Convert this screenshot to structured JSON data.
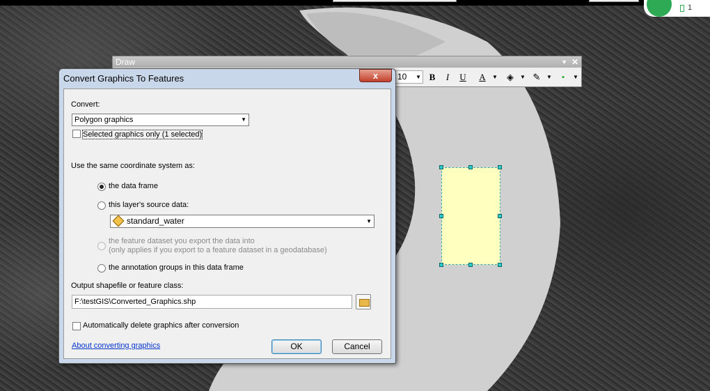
{
  "notification": {
    "count": "1"
  },
  "draw_toolbar": {
    "title": "Draw",
    "font_size": "10",
    "bold": "B",
    "italic": "I",
    "underline": "U",
    "font_color": "A"
  },
  "dialog": {
    "title": "Convert Graphics To Features",
    "close_label": "x",
    "convert_label": "Convert:",
    "convert_value": "Polygon graphics",
    "selected_only_label": "Selected graphics only  (1 selected)",
    "coord_label": "Use the same coordinate system as:",
    "options": {
      "data_frame": "the data frame",
      "layer_source": "this layer's source data:",
      "layer_value": "standard_water",
      "feature_dataset_line1": "the feature dataset you export the data into",
      "feature_dataset_line2": "(only applies if you export to a feature dataset in a geodatabase)",
      "annotation_groups": "the annotation groups in this data frame"
    },
    "output_label": "Output shapefile or feature class:",
    "output_value": "F:\\testGIS\\Converted_Graphics.shp",
    "auto_delete_label": "Automatically delete graphics after conversion",
    "help_link": "About converting graphics",
    "ok_label": "OK",
    "cancel_label": "Cancel"
  },
  "colors": {
    "rect_fill": "#ffffc0",
    "selection_handle": "#33cccc",
    "link": "#0033cc"
  }
}
